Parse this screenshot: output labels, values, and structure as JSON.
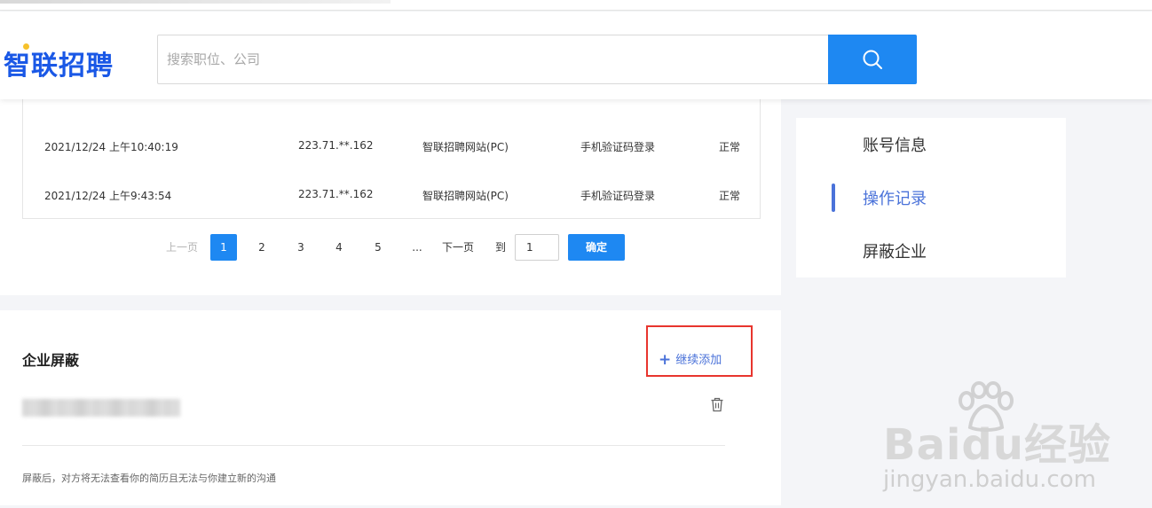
{
  "header": {
    "logo": "智联招聘",
    "search_placeholder": "搜索职位、公司"
  },
  "records": {
    "rows": [
      {
        "time": "2021/12/24 上午10:40:19",
        "ip": "223.71.**.162",
        "source": "智联招聘网站(PC)",
        "method": "手机验证码登录",
        "status": "正常"
      },
      {
        "time": "2021/12/24 上午9:43:54",
        "ip": "223.71.**.162",
        "source": "智联招聘网站(PC)",
        "method": "手机验证码登录",
        "status": "正常"
      }
    ]
  },
  "pagination": {
    "prev": "上一页",
    "pages": [
      "1",
      "2",
      "3",
      "4",
      "5"
    ],
    "ellipsis": "...",
    "next": "下一页",
    "goto_label": "到",
    "goto_value": "1",
    "confirm": "确定",
    "current": "1"
  },
  "block": {
    "title": "企业屏蔽",
    "add_label": "继续添加",
    "note": "屏蔽后，对方将无法查看你的简历且无法与你建立新的沟通"
  },
  "side_menu": {
    "items": [
      "账号信息",
      "操作记录",
      "屏蔽企业"
    ],
    "active": "操作记录"
  },
  "watermark": {
    "brand": "Baidu经验",
    "url": "jingyan.baidu.com"
  },
  "colors": {
    "brand_blue": "#1a58e6",
    "button_blue": "#1e88f2",
    "link_blue": "#4a72d9",
    "highlight_red": "#e8352e"
  }
}
